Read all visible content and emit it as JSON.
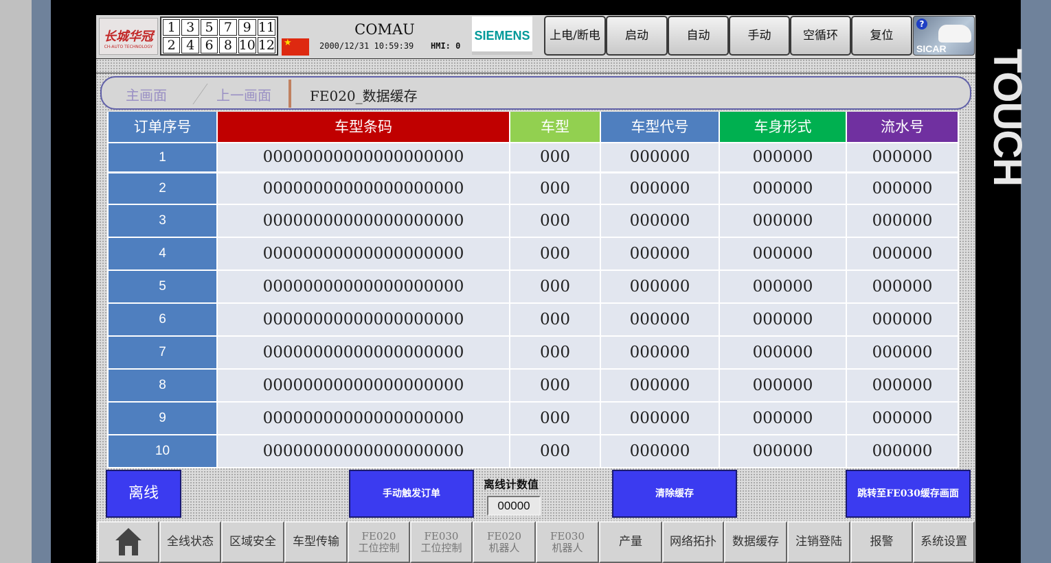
{
  "header": {
    "logo_cn": "长城华冠",
    "logo_en": "CH-AUTO TECHNOLOGY",
    "station_numbers": [
      "1",
      "3",
      "5",
      "7",
      "9",
      "11",
      "2",
      "4",
      "6",
      "8",
      "10",
      "12"
    ],
    "brand": "COMAU",
    "datetime": "2000/12/31 10:59:39",
    "hmi_label": "HMI: 0",
    "siemens": "SIEMENS",
    "buttons": [
      "上电/断电",
      "启动",
      "自动",
      "手动",
      "空循环",
      "复位"
    ],
    "sicar_label": "SICAR",
    "help_icon": "?"
  },
  "bezel": {
    "touch_label": "TOUCH"
  },
  "breadcrumb": {
    "home": "主画面",
    "previous": "上一画面",
    "title": "FE020_数据缓存"
  },
  "table": {
    "headers": [
      "订单序号",
      "车型条码",
      "车型",
      "车型代号",
      "车身形式",
      "流水号"
    ],
    "header_colors": [
      "#4f7fbf",
      "#c00000",
      "#92d050",
      "#4f7fbf",
      "#00b050",
      "#7030a0"
    ],
    "rows": [
      [
        "1",
        "00000000000000000000",
        "000",
        "000000",
        "000000",
        "000000"
      ],
      [
        "2",
        "00000000000000000000",
        "000",
        "000000",
        "000000",
        "000000"
      ],
      [
        "3",
        "00000000000000000000",
        "000",
        "000000",
        "000000",
        "000000"
      ],
      [
        "4",
        "00000000000000000000",
        "000",
        "000000",
        "000000",
        "000000"
      ],
      [
        "5",
        "00000000000000000000",
        "000",
        "000000",
        "000000",
        "000000"
      ],
      [
        "6",
        "00000000000000000000",
        "000",
        "000000",
        "000000",
        "000000"
      ],
      [
        "7",
        "00000000000000000000",
        "000",
        "000000",
        "000000",
        "000000"
      ],
      [
        "8",
        "00000000000000000000",
        "000",
        "000000",
        "000000",
        "000000"
      ],
      [
        "9",
        "00000000000000000000",
        "000",
        "000000",
        "000000",
        "000000"
      ],
      [
        "10",
        "00000000000000000000",
        "000",
        "000000",
        "000000",
        "000000"
      ]
    ]
  },
  "controls": {
    "offline": "离线",
    "manual_trigger": "手动触发订单",
    "counter_label": "离线计数值",
    "counter_value": "00000",
    "clear_cache": "清除缓存",
    "jump": "跳转至FE030缓存画面"
  },
  "nav": [
    {
      "label": "",
      "icon": "home-icon"
    },
    {
      "label": "全线状态"
    },
    {
      "label": "区域安全"
    },
    {
      "label": "车型传输"
    },
    {
      "label": "FE020\n工位控制"
    },
    {
      "label": "FE030\n工位控制"
    },
    {
      "label": "FE020\n机器人"
    },
    {
      "label": "FE030\n机器人"
    },
    {
      "label": "产量"
    },
    {
      "label": "网络拓扑"
    },
    {
      "label": "数据缓存"
    },
    {
      "label": "注销登陆"
    },
    {
      "label": "报警"
    },
    {
      "label": "系统设置"
    }
  ]
}
